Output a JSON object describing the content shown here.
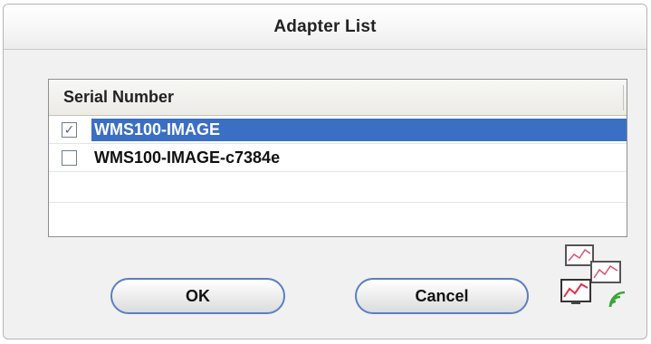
{
  "dialog": {
    "title": "Adapter List"
  },
  "list": {
    "column_header": "Serial Number",
    "rows": [
      {
        "label": "WMS100-IMAGE",
        "checked": true,
        "selected": true
      },
      {
        "label": "WMS100-IMAGE-c7384e",
        "checked": false,
        "selected": false
      }
    ]
  },
  "buttons": {
    "ok_label": "OK",
    "cancel_label": "Cancel"
  },
  "icons": {
    "checkmark": "✓",
    "logo": "wireless-monitor-logo-icon"
  },
  "colors": {
    "selection": "#3a6fc4",
    "button_border": "#5a7fc0"
  }
}
